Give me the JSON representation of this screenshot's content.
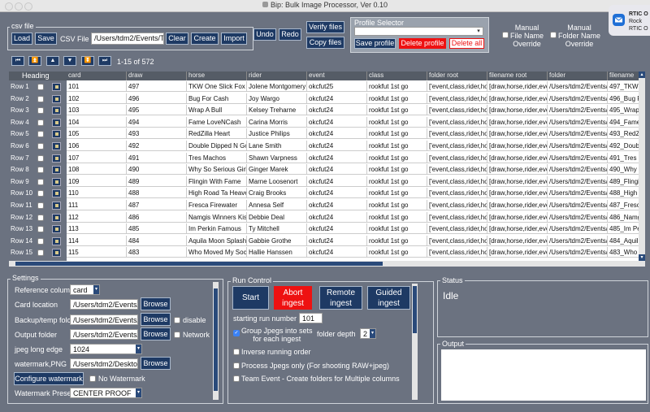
{
  "app": {
    "title": "Bip: Bulk Image Processor, Ver 0.10"
  },
  "notification": {
    "line1": "RTIC O",
    "line2": "Rock",
    "line3": "RTIC O"
  },
  "csv_file": {
    "frame_label": "csv file",
    "load": "Load",
    "save": "Save",
    "csv_label": "CSV File",
    "csv_path": "/Users/tdm2/Events/TC",
    "clear": "Clear",
    "create": "Create",
    "import": "Import"
  },
  "toolbar": {
    "undo": "Undo",
    "redo": "Redo",
    "verify_files": "Verify files",
    "copy_files": "Copy files"
  },
  "profile": {
    "frame_label": "Profile Selector",
    "select_value": "",
    "save": "Save profile",
    "delete": "Delete profile",
    "delete_all": "Delete all"
  },
  "overrides": {
    "manual_file": "Manual\nFile Name\nOverride",
    "manual_folder": "Manual\nFolder Name\nOverride"
  },
  "nav": {
    "page_info": "1-15 of 572",
    "heading": "Heading"
  },
  "table": {
    "columns": [
      "card",
      "draw",
      "horse",
      "rider",
      "event",
      "class",
      "folder root",
      "filename root",
      "folder",
      "filename"
    ],
    "rows": [
      {
        "label": "Row 1",
        "card": "101",
        "draw": "497",
        "horse": "TKW One Slick Fox",
        "rider": "Jolene Montgomery",
        "event": "okcfut25",
        "class": "rookfut 1st go",
        "folder_root": "['event,class,rider,hor",
        "filename_root": "[draw,horse,rider,even",
        "folder": "/Users/tdm2/Events/Tc",
        "filename": "497_TKW"
      },
      {
        "label": "Row 2",
        "card": "102",
        "draw": "496",
        "horse": "Bug For Cash",
        "rider": "Joy Wargo",
        "event": "okcfut24",
        "class": "rookfut 1st go",
        "folder_root": "['event,class,rider,hor",
        "filename_root": "[draw,horse,rider,even",
        "folder": "/Users/tdm2/Events/Tc",
        "filename": "496_Bug F"
      },
      {
        "label": "Row 3",
        "card": "103",
        "draw": "495",
        "horse": "Wrap A Bull",
        "rider": "Kelsey Treharne",
        "event": "okcfut24",
        "class": "rookfut 1st go",
        "folder_root": "['event,class,rider,hor",
        "filename_root": "[draw,horse,rider,even",
        "folder": "/Users/tdm2/Events/Tc",
        "filename": "495_Wrap"
      },
      {
        "label": "Row 4",
        "card": "104",
        "draw": "494",
        "horse": "Fame LoveNCash",
        "rider": "Carina Morris",
        "event": "okcfut24",
        "class": "rookfut 1st go",
        "folder_root": "['event,class,rider,hor",
        "filename_root": "[draw,horse,rider,even",
        "folder": "/Users/tdm2/Events/Tc",
        "filename": "494_Fame"
      },
      {
        "label": "Row 5",
        "card": "105",
        "draw": "493",
        "horse": "RedZilla Heart",
        "rider": "Justice Philips",
        "event": "okcfut24",
        "class": "rookfut 1st go",
        "folder_root": "['event,class,rider,hor",
        "filename_root": "[draw,horse,rider,even",
        "folder": "/Users/tdm2/Events/Tc",
        "filename": "493_RedZ"
      },
      {
        "label": "Row 6",
        "card": "106",
        "draw": "492",
        "horse": "Double Dipped N Gold",
        "rider": "Lane Smith",
        "event": "okcfut24",
        "class": "rookfut 1st go",
        "folder_root": "['event,class,rider,hor",
        "filename_root": "[draw,horse,rider,even",
        "folder": "/Users/tdm2/Events/Tc",
        "filename": "492_Doub"
      },
      {
        "label": "Row 7",
        "card": "107",
        "draw": "491",
        "horse": "Tres Machos",
        "rider": "Shawn Varpness",
        "event": "okcfut24",
        "class": "rookfut 1st go",
        "folder_root": "['event,class,rider,hor",
        "filename_root": "[draw,horse,rider,even",
        "folder": "/Users/tdm2/Events/Tc",
        "filename": "491_Tres M"
      },
      {
        "label": "Row 8",
        "card": "108",
        "draw": "490",
        "horse": "Why So Serious Girls",
        "rider": "Ginger Marek",
        "event": "okcfut24",
        "class": "rookfut 1st go",
        "folder_root": "['event,class,rider,hor",
        "filename_root": "[draw,horse,rider,even",
        "folder": "/Users/tdm2/Events/Tc",
        "filename": "490_Why S"
      },
      {
        "label": "Row 9",
        "card": "109",
        "draw": "489",
        "horse": "Flingin With Fame",
        "rider": "Marne Loosenort",
        "event": "okcfut24",
        "class": "rookfut 1st go",
        "folder_root": "['event,class,rider,hor",
        "filename_root": "[draw,horse,rider,even",
        "folder": "/Users/tdm2/Events/Tc",
        "filename": "489_Flingi"
      },
      {
        "label": "Row 10",
        "card": "110",
        "draw": "488",
        "horse": "High Road Ta Heaven",
        "rider": "Craig Brooks",
        "event": "okcfut24",
        "class": "rookfut 1st go",
        "folder_root": "['event,class,rider,hor",
        "filename_root": "[draw,horse,rider,even",
        "folder": "/Users/tdm2/Events/Tc",
        "filename": "488_High"
      },
      {
        "label": "Row 11",
        "card": "111",
        "draw": "487",
        "horse": "Fresca Firewater",
        "rider": "Annesa Self",
        "event": "okcfut24",
        "class": "rookfut 1st go",
        "folder_root": "['event,class,rider,hor",
        "filename_root": "[draw,horse,rider,even",
        "folder": "/Users/tdm2/Events/Tc",
        "filename": "487_Fresc"
      },
      {
        "label": "Row 12",
        "card": "112",
        "draw": "486",
        "horse": "Namgis Winners Kiss",
        "rider": "Debbie Deal",
        "event": "okcfut24",
        "class": "rookfut 1st go",
        "folder_root": "['event,class,rider,hor",
        "filename_root": "[draw,horse,rider,even",
        "folder": "/Users/tdm2/Events/Tc",
        "filename": "486_Namg"
      },
      {
        "label": "Row 13",
        "card": "113",
        "draw": "485",
        "horse": "Im Perkin Famous",
        "rider": "Ty Mitchell",
        "event": "okcfut24",
        "class": "rookfut 1st go",
        "folder_root": "['event,class,rider,hor",
        "filename_root": "[draw,horse,rider,even",
        "folder": "/Users/tdm2/Events/Tc",
        "filename": "485_Im Pe"
      },
      {
        "label": "Row 14",
        "card": "114",
        "draw": "484",
        "horse": "Aquila Moon Splash",
        "rider": "Gabbie Grothe",
        "event": "okcfut24",
        "class": "rookfut 1st go",
        "folder_root": "['event,class,rider,hor",
        "filename_root": "[draw,horse,rider,even",
        "folder": "/Users/tdm2/Events/Tc",
        "filename": "484_Aquil"
      },
      {
        "label": "Row 15",
        "card": "115",
        "draw": "483",
        "horse": "Who Moved My Socks",
        "rider": "Hallie Hanssen",
        "event": "okcfut24",
        "class": "rookfut 1st go",
        "folder_root": "['event,class,rider,hor",
        "filename_root": "[draw,horse,rider,even",
        "folder": "/Users/tdm2/Events/Tc",
        "filename": "483_Who"
      }
    ]
  },
  "settings": {
    "frame_label": "Settings",
    "reference_label": "Reference colum",
    "reference_value": "card",
    "card_location_label": "Card location",
    "card_location_value": "/Users/tdm2/Events/",
    "backup_label": "Backup/temp folc",
    "backup_value": "/Users/tdm2/Events/",
    "disable_label": "disable",
    "output_label": "Output folder",
    "output_value": "/Users/tdm2/Events/",
    "network_label": "Network",
    "jpeg_label": "jpeg long edge",
    "jpeg_value": "1024",
    "watermark_label": "watermark,PNG",
    "watermark_value": "/Users/tdm2/Desktop",
    "browse": "Browse",
    "configure_watermark": "Configure watermark",
    "no_watermark_label": "No Watermark",
    "watermark_preset_label": "Watermark Prese",
    "watermark_preset_value": "CENTER PROOF"
  },
  "run_control": {
    "frame_label": "Run Control",
    "start": "Start",
    "abort": "Abort\ningest",
    "remote": "Remote\ningest",
    "guided": "Guided\ningest",
    "starting_run_label": "starting run number",
    "starting_run_value": "101",
    "group_label": "Group Jpegs into sets\nfor each ingest",
    "folder_depth_label": "folder depth",
    "folder_depth_value": "2",
    "inverse_label": "Inverse running order",
    "process_jpegs_label": "Process Jpegs only (For shooting RAW+jpeg)",
    "team_event_label": "Team Event - Create folders for Multiple columns"
  },
  "status": {
    "frame_label": "Status",
    "value": "Idle"
  },
  "output": {
    "frame_label": "Output"
  },
  "colors": {
    "bg": "#6b7280",
    "button": "#1e3a64",
    "danger": "#ee1111"
  }
}
